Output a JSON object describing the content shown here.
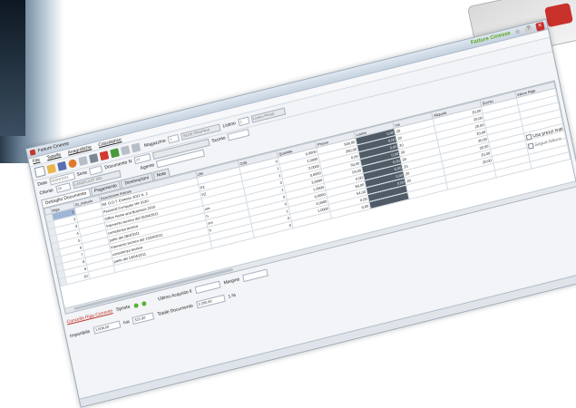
{
  "brand": "Fatture Cinesse",
  "window_title": "Fatture Cinesse",
  "menu": [
    "File",
    "Tabelle",
    "Anagrafiche",
    "Calcolatrice"
  ],
  "toolbar": {
    "magazzino_label": "Magazzino",
    "magazzino_value": "1",
    "magazzino_name": "SEDE PROPRIA",
    "listino_label": "Listino",
    "listino_value": "1",
    "listino_name": "Listino Privati"
  },
  "form": {
    "data_label": "Data",
    "data_value": "05/04/2011",
    "serie_label": "Serie",
    "documento_label": "Documento N",
    "documento_value": "24",
    "cliente_label": "Cliente",
    "cliente_code": "68",
    "cliente_name": "LANDPLAST SRL",
    "agente_label": "Agente",
    "sconto_label": "Sconto"
  },
  "tabs": [
    "Dettaglio Documento",
    "Pagamento",
    "Destinazioni",
    "Note"
  ],
  "grid": {
    "columns": [
      "Riga",
      "ID_Articolo",
      "Descrizione Articolo",
      "UM",
      "CdS",
      "Quantita",
      "Prezzo",
      "Listino",
      "Iva",
      "Aliquota",
      "Sconto",
      "Valore Riga"
    ],
    "rows": [
      {
        "riga": "1",
        "desc": "Rif. D.D.T. Emesso 2011 N. 2",
        "um": "",
        "cds": "0",
        "qta": "0,0000",
        "prezzo": "500,00",
        "listino": "0,00",
        "iva": "20",
        "aliquota": "20,00"
      },
      {
        "riga": "2",
        "desc": "Personal Computer HP 3120",
        "um": "PZ",
        "cds": "1",
        "qta": "1,0000",
        "prezzo": "260,00",
        "listino": "0,00",
        "iva": "20",
        "aliquota": "20,00"
      },
      {
        "riga": "3",
        "desc": "Office Home and Business 2010",
        "um": "PZ",
        "cds": "1",
        "qta": "2,0000",
        "prezzo": "0,00",
        "listino": "0,00",
        "iva": "20",
        "aliquota": "20,00"
      },
      {
        "riga": "4",
        "desc": "Intervento tecnico del 05/04/2011",
        "um": "",
        "cds": "0",
        "qta": "0,0000",
        "prezzo": "50,00",
        "listino": "0,00",
        "iva": "20",
        "aliquota": "20,00"
      },
      {
        "riga": "5",
        "desc": "consulenza tecnica",
        "um": "ore",
        "cds": "1",
        "qta": "3,0000",
        "prezzo": "54,00",
        "listino": "0,00",
        "iva": "20",
        "aliquota": "20,00"
      },
      {
        "riga": "6",
        "desc": "parte del 28/4/2011",
        "um": "h",
        "cds": "0",
        "qta": "1,0000",
        "prezzo": "0,00",
        "listino": "0,00",
        "iva": "20",
        "aliquota": "20,00"
      },
      {
        "riga": "7",
        "desc": "Intervento tecnico del 13/04/2011",
        "um": "ore",
        "cds": "0",
        "qta": "0,0000",
        "prezzo": "60,00",
        "listino": "0,00",
        "iva": "20",
        "aliquota": "20,00"
      },
      {
        "riga": "8",
        "desc": "consulenza tecnica",
        "um": "h",
        "cds": "1",
        "qta": "4,0000",
        "prezzo": "54,00",
        "listino": "0,00",
        "iva": "20",
        "aliquota": "20,00"
      },
      {
        "riga": "9",
        "desc": "parte del 13/04/2011",
        "um": "",
        "cds": "0",
        "qta": "1,0000",
        "prezzo": "0,00",
        "listino": "",
        "iva": "",
        "aliquota": ""
      },
      {
        "riga": "10",
        "desc": "",
        "um": "",
        "cds": "0",
        "qta": "",
        "prezzo": "0,00",
        "listino": "",
        "iva": "",
        "aliquota": ""
      }
    ]
  },
  "side": {
    "usa_prezzi": "Usa prezzi Ivati",
    "segue_fattura": "Segue fattura"
  },
  "bottom": {
    "cancella": "Cancella Riga Corrente",
    "sposta_label": "Sposta",
    "ultimo_acquisto_label": "Ultimo Acquisto €",
    "margine_label": "Margine",
    "imponibile_label": "Imponibile",
    "imponibile_value": "1.608,00",
    "iva_label": "Iva",
    "iva_value": "321,60",
    "totale_label": "Totale Documento",
    "totale_value": "2.265,60",
    "percent_value": "1.%"
  },
  "colors": {
    "brand_green": "#5aa81f",
    "selected_cell": "#9fb5d6",
    "link_red": "#c0392b"
  },
  "icons": [
    "new-doc-icon",
    "open-folder-icon",
    "save-icon",
    "undo-icon",
    "preview-icon",
    "print-icon",
    "pdf-icon",
    "excel-icon",
    "star-icon",
    "help-icon",
    "close-icon"
  ]
}
